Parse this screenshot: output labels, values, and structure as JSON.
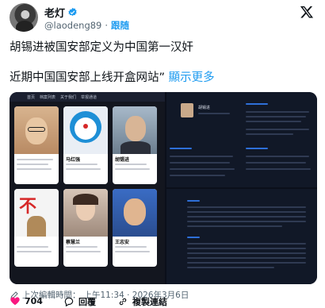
{
  "author": {
    "name": "老灯",
    "handle": "@laodeng89",
    "follow_label": "跟随"
  },
  "post": {
    "line1": "胡锡进被国安部定义为中国第一汉奸",
    "line2": "近期中国国安部上线开盒网站”",
    "more_label": "顯示更多"
  },
  "media": {
    "nav_items": [
      "首页",
      "档案列表",
      "关于我们",
      "举报通道"
    ],
    "cards": [
      {
        "name": "",
        "face": "face1"
      },
      {
        "name": "马红强",
        "face": "face2"
      },
      {
        "name": "胡锡进",
        "face": "face3"
      },
      {
        "name": "",
        "face": "face4"
      },
      {
        "name": "蔡慧兰",
        "face": "face5"
      },
      {
        "name": "王志安",
        "face": "face6"
      }
    ],
    "profile_name": "胡锡进",
    "sign_text": "不"
  },
  "meta": {
    "edited_label": "上次編輯時間：",
    "time": "上午11:34 · 2026年3月6日"
  },
  "actions": {
    "likes": "704",
    "reply_label": "回覆",
    "copy_label": "複製連結"
  },
  "colors": {
    "accent": "#1d9bf0",
    "like": "#f91880",
    "text": "#0f1419",
    "muted": "#536471"
  }
}
